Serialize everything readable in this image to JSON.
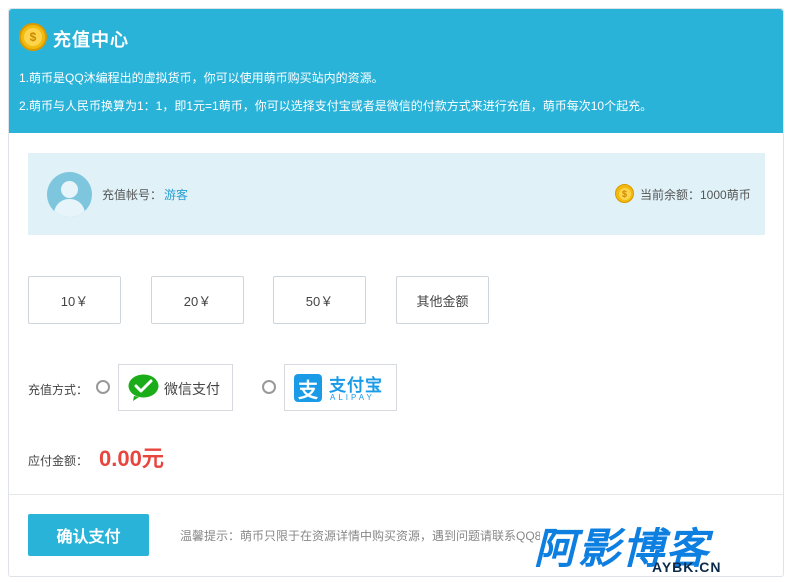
{
  "header": {
    "title": "充值中心",
    "coin_symbol": "$",
    "line1": "1.萌币是QQ沐编程出的虚拟货币，你可以使用萌币购买站内的资源。",
    "line2": "2.萌币与人民币换算为1：1，即1元=1萌币，你可以选择支付宝或者是微信的付款方式来进行充值，萌币每次10个起充。"
  },
  "account": {
    "label": "充值帐号：",
    "username": "游客",
    "balance_label": "当前余额：1000萌币",
    "coin_symbol": "$"
  },
  "amounts": [
    "10￥",
    "20￥",
    "50￥",
    "其他金额"
  ],
  "payment": {
    "label": "充值方式：",
    "wechat_label": "微信支付",
    "alipay_label": "支付宝",
    "alipay_sub": "ALIPAY",
    "alipay_icon": "支"
  },
  "due": {
    "label": "应付金额：",
    "value": "0.00元"
  },
  "confirm_label": "确认支付",
  "tip": "温馨提示：萌币只限于在资源详情中购买资源，遇到问题请联系QQ81",
  "watermark": {
    "big": "阿影博客",
    "small": "AYBK.CN"
  },
  "colors": {
    "accent": "#2ab3d9",
    "due": "#e9453f",
    "wechat": "#1aad19",
    "alipay": "#1a9be8"
  }
}
